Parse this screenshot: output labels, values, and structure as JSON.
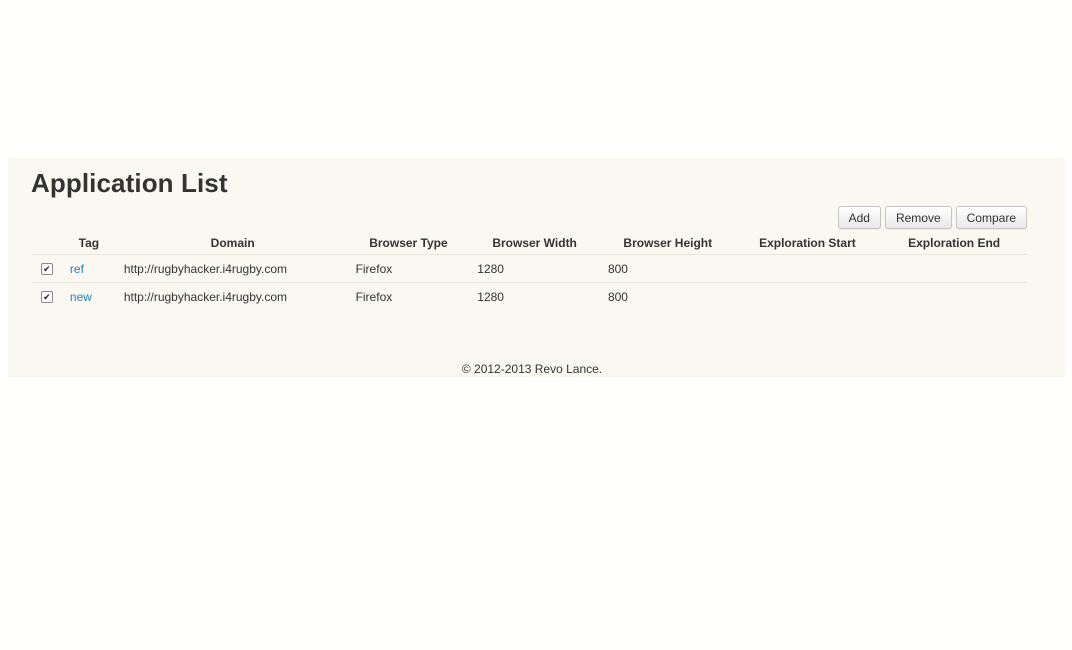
{
  "page": {
    "title": "Application List"
  },
  "toolbar": {
    "add_label": "Add",
    "remove_label": "Remove",
    "compare_label": "Compare"
  },
  "table": {
    "headers": {
      "tag": "Tag",
      "domain": "Domain",
      "browser_type": "Browser Type",
      "browser_width": "Browser Width",
      "browser_height": "Browser Height",
      "exploration_start": "Exploration Start",
      "exploration_end": "Exploration End"
    },
    "rows": [
      {
        "checked": true,
        "tag": "ref",
        "domain": "http://rugbyhacker.i4rugby.com",
        "browser_type": "Firefox",
        "browser_width": "1280",
        "browser_height": "800",
        "exploration_start": "",
        "exploration_end": ""
      },
      {
        "checked": true,
        "tag": "new",
        "domain": "http://rugbyhacker.i4rugby.com",
        "browser_type": "Firefox",
        "browser_width": "1280",
        "browser_height": "800",
        "exploration_start": "",
        "exploration_end": ""
      }
    ]
  },
  "footer": {
    "text": "© 2012-2013 Revo Lance."
  },
  "colors": {
    "panel_bg": "#f9f9f2",
    "link": "#2a7fc1"
  }
}
